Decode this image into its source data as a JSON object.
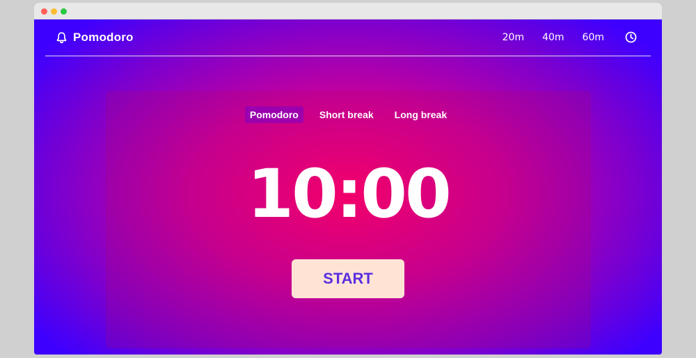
{
  "window": {
    "controls": [
      "close",
      "minimize",
      "maximize"
    ]
  },
  "header": {
    "brand_icon": "bell-icon",
    "brand_label": "Pomodoro",
    "nav": [
      {
        "label": "20m"
      },
      {
        "label": "40m"
      },
      {
        "label": "60m"
      }
    ],
    "clock_icon": "clock-icon"
  },
  "timer": {
    "tabs": [
      {
        "label": "Pomodoro",
        "active": true
      },
      {
        "label": "Short break",
        "active": false
      },
      {
        "label": "Long break",
        "active": false
      }
    ],
    "time": "10:00",
    "start_label": "START"
  },
  "colors": {
    "accent": "#ff006e",
    "background": "#3d00ff",
    "button_bg": "#ffe4d6",
    "button_text": "#5a2ee0"
  }
}
